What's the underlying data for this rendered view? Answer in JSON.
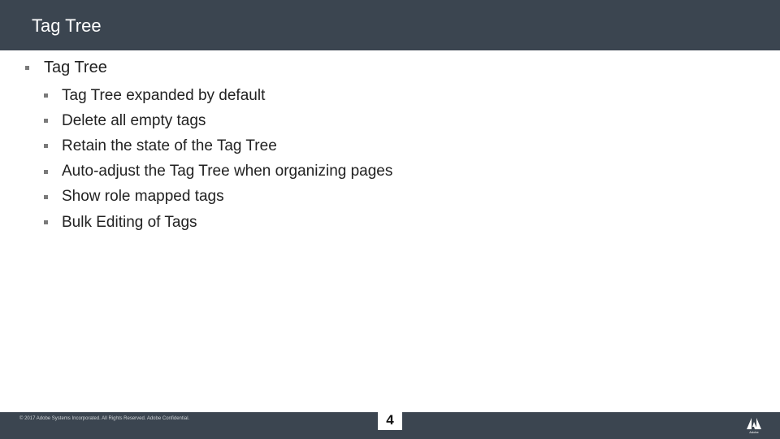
{
  "slide": {
    "title": "Tag Tree",
    "bullet_l1": "Tag Tree",
    "sub_bullets": [
      "Tag Tree expanded by default",
      "Delete all empty tags",
      "Retain the state of the Tag Tree",
      "Auto-adjust the Tag Tree when organizing pages",
      "Show role mapped tags",
      "Bulk Editing of Tags"
    ]
  },
  "footer": {
    "copyright": "© 2017 Adobe Systems Incorporated.  All Rights Reserved.  Adobe Confidential.",
    "page_number": "4",
    "logo_text": "Adobe"
  },
  "colors": {
    "bar": "#3b4550",
    "text": "#222222",
    "marker": "#7a7a7a"
  }
}
